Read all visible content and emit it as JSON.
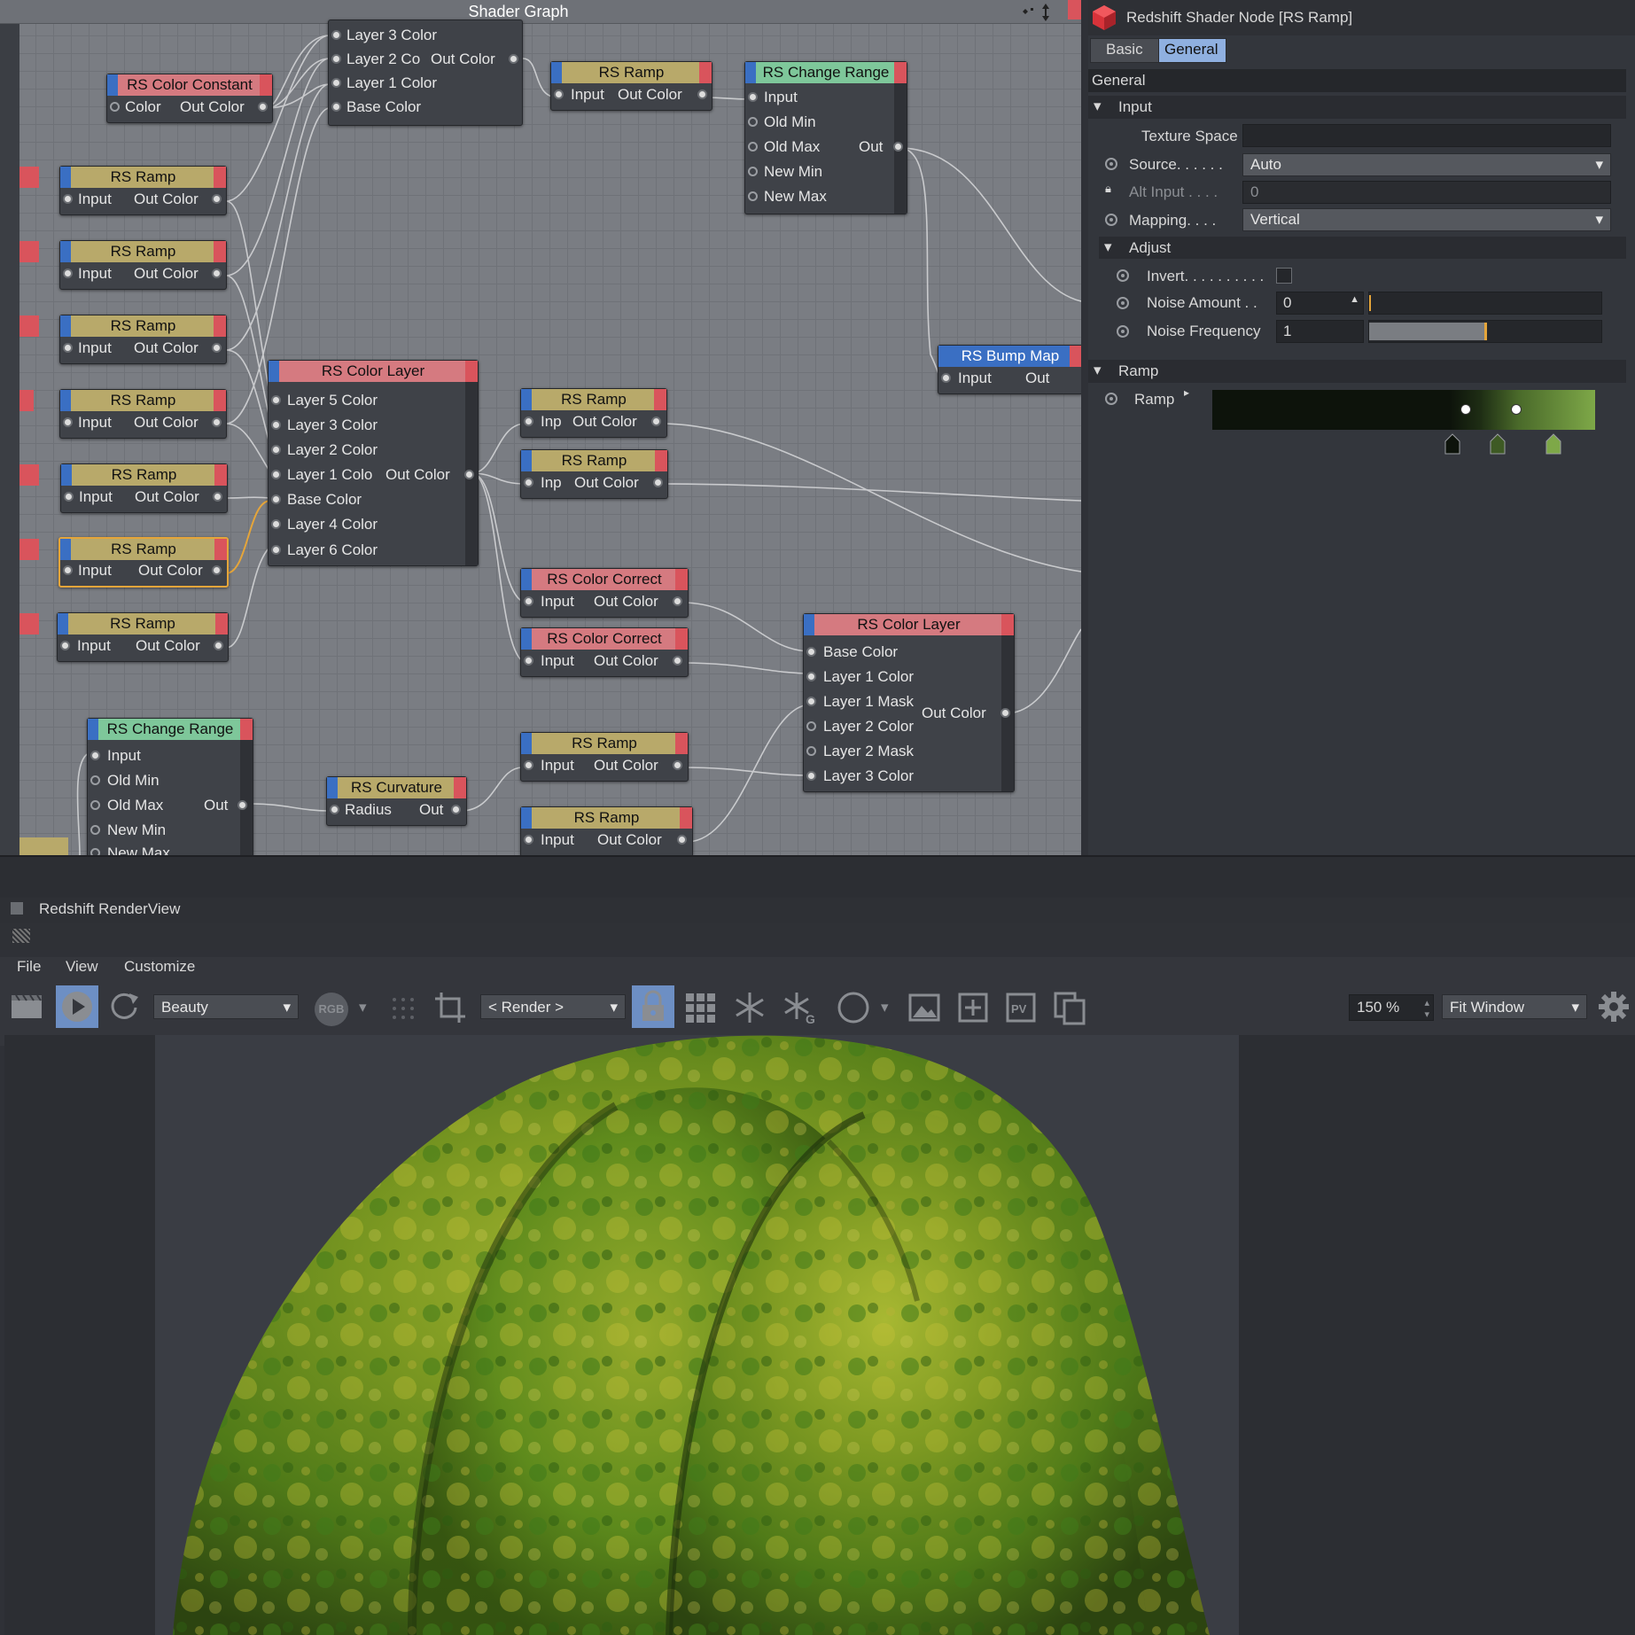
{
  "shader_graph": {
    "title": "Shader Graph",
    "nodes": {
      "layer_top": {
        "ports": [
          "Layer 3 Color",
          "Layer 2 Co",
          "Layer 1 Color",
          "Base Color"
        ],
        "out": "Out Color"
      },
      "color_constant": {
        "title": "RS Color Constant",
        "in": "Color",
        "out": "Out Color"
      },
      "ramp_top": {
        "title": "RS Ramp",
        "in": "Input",
        "out": "Out Color"
      },
      "change_range_top": {
        "title": "RS Change Range",
        "ports": [
          "Input",
          "Old Min",
          "Old Max",
          "New Min",
          "New Max"
        ],
        "out": "Out"
      },
      "ramps_left": [
        {
          "title": "RS Ramp",
          "in": "Input",
          "out": "Out Color"
        },
        {
          "title": "RS Ramp",
          "in": "Input",
          "out": "Out Color"
        },
        {
          "title": "RS Ramp",
          "in": "Input",
          "out": "Out Color"
        },
        {
          "title": "RS Ramp",
          "in": "Input",
          "out": "Out Color"
        },
        {
          "title": "RS Ramp",
          "in": "Input",
          "out": "Out Color"
        },
        {
          "title": "RS Ramp",
          "in": "Input",
          "out": "Out Color"
        },
        {
          "title": "RS Ramp",
          "in": "Input",
          "out": "Out Color"
        }
      ],
      "color_layer_mid": {
        "title": "RS Color Layer",
        "ports": [
          "Layer 5 Color",
          "Layer 3 Color",
          "Layer 2 Color",
          "Layer 1 Colo",
          "Base Color",
          "Layer 4 Color",
          "Layer 6 Color"
        ],
        "out": "Out Color"
      },
      "ramp_mid1": {
        "title": "RS Ramp",
        "in": "Inp",
        "out": "Out Color"
      },
      "ramp_mid2": {
        "title": "RS Ramp",
        "in": "Inp",
        "out": "Out Color"
      },
      "bump_map": {
        "title": "RS Bump Map",
        "in": "Input",
        "out": "Out"
      },
      "color_correct1": {
        "title": "RS Color Correct",
        "in": "Input",
        "out": "Out Color"
      },
      "color_correct2": {
        "title": "RS Color Correct",
        "in": "Input",
        "out": "Out Color"
      },
      "color_layer_low": {
        "title": "RS Color Layer",
        "ports": [
          "Base Color",
          "Layer 1 Color",
          "Layer 1 Mask",
          "Layer 2 Color",
          "Layer 2 Mask",
          "Layer 3 Color"
        ],
        "out": "Out Color"
      },
      "change_range_low": {
        "title": "RS Change Range",
        "ports": [
          "Input",
          "Old Min",
          "Old Max",
          "New Min",
          "New Max"
        ],
        "out": "Out"
      },
      "curvature": {
        "title": "RS Curvature",
        "in": "Radius",
        "out": "Out"
      },
      "ramp_low1": {
        "title": "RS Ramp",
        "in": "Input",
        "out": "Out Color"
      },
      "ramp_low2": {
        "title": "RS Ramp",
        "in": "Input",
        "out": "Out Color"
      }
    }
  },
  "attributes": {
    "title": "Redshift Shader Node [RS Ramp]",
    "tabs": [
      "Basic",
      "General"
    ],
    "active_tab": "General",
    "section": "General",
    "input_group": "Input",
    "texture_space_label": "Texture Space",
    "source_label": "Source. . . . . .",
    "source_value": "Auto",
    "alt_input_label": "Alt Input . . . .",
    "alt_input_value": "0",
    "mapping_label": "Mapping. . . .",
    "mapping_value": "Vertical",
    "adjust_group": "Adjust",
    "invert_label": "Invert. . . . . . . . . .",
    "noise_amount_label": "Noise Amount . .",
    "noise_amount_value": "0",
    "noise_frequency_label": "Noise Frequency",
    "noise_frequency_value": "1",
    "ramp_group": "Ramp",
    "ramp_label": "Ramp",
    "accent_color": "#e5a53a"
  },
  "renderview": {
    "title": "Redshift RenderView",
    "menu": [
      "File",
      "View",
      "Customize"
    ],
    "aov_value": "Beauty",
    "rgb_label": "RGB",
    "camera_value": "< Render >",
    "zoom_value": "150 %",
    "fit_value": "Fit Window"
  }
}
